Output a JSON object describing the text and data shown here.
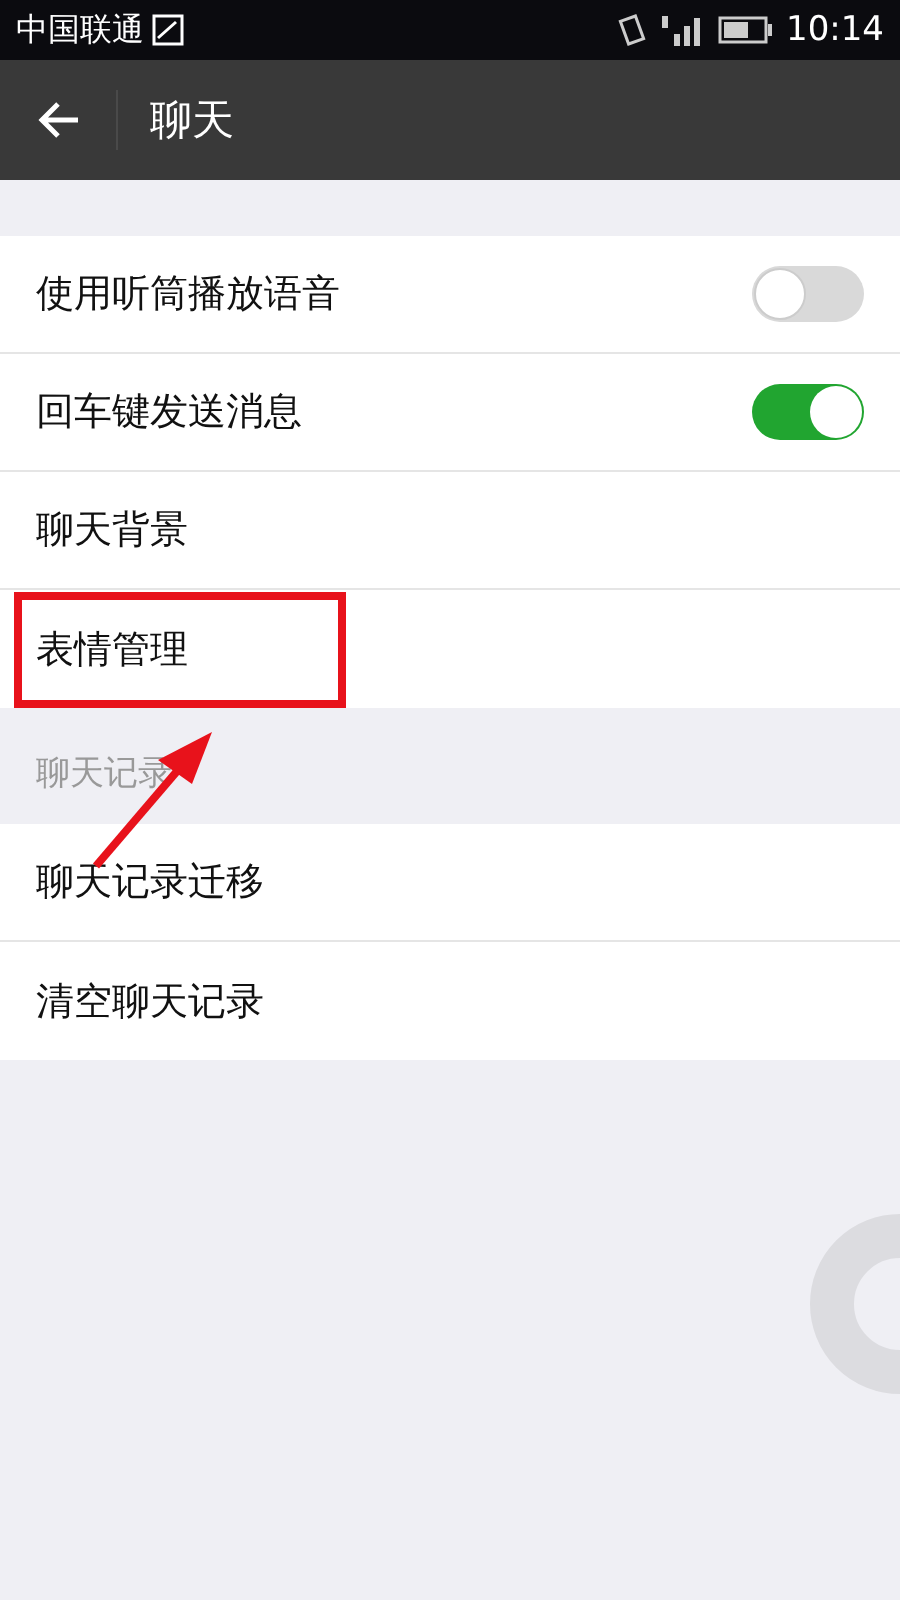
{
  "status_bar": {
    "carrier": "中国联通",
    "time": "10:14"
  },
  "toolbar": {
    "title": "聊天"
  },
  "sections": [
    {
      "items": [
        {
          "label": "使用听筒播放语音",
          "kind": "toggle",
          "on": false
        },
        {
          "label": "回车键发送消息",
          "kind": "toggle",
          "on": true
        },
        {
          "label": "聊天背景",
          "kind": "link"
        },
        {
          "label": "表情管理",
          "kind": "link"
        }
      ]
    },
    {
      "header": "聊天记录",
      "items": [
        {
          "label": "聊天记录迁移",
          "kind": "link"
        },
        {
          "label": "清空聊天记录",
          "kind": "link"
        }
      ]
    }
  ]
}
